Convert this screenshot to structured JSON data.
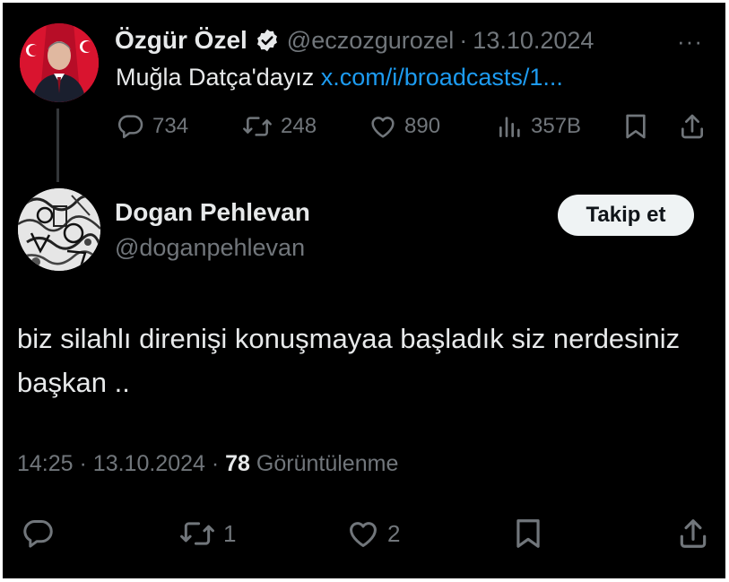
{
  "parent_tweet": {
    "author_name": "Özgür Özel",
    "verified": true,
    "handle": "@eczozgurozel",
    "separator": "·",
    "date": "13.10.2024",
    "more_label": "···",
    "text": "Muğla Datça'dayız ",
    "link_text": "x.com/i/broadcasts/1...",
    "stats": {
      "replies": "734",
      "reposts": "248",
      "likes": "890",
      "views": "357B"
    }
  },
  "reply_tweet": {
    "author_name": "Dogan Pehlevan",
    "handle": "@doganpehlevan",
    "follow_label": "Takip et",
    "text": "biz silahlı direnişi konuşmayaa başladık siz nerdesiniz başkan ..",
    "meta": {
      "time": "14:25",
      "separator": "·",
      "date": "13.10.2024",
      "views_count": "78",
      "views_label": "Görüntülenme"
    },
    "stats": {
      "reposts": "1",
      "likes": "2"
    }
  },
  "icons": {
    "reply": "reply-icon",
    "repost": "repost-icon",
    "like": "heart-icon",
    "views": "views-icon",
    "bookmark": "bookmark-icon",
    "share": "share-icon",
    "verified": "verified-badge-icon"
  },
  "colors": {
    "background": "#000000",
    "primary_text": "#e7e9ea",
    "secondary_text": "#71767b",
    "link": "#1d9bf0",
    "follow_button_bg": "#eff3f4"
  }
}
